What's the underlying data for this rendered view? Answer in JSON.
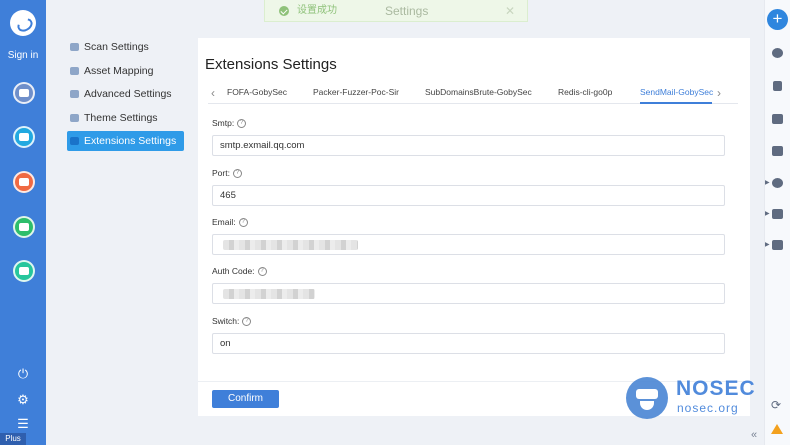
{
  "toast": {
    "message": "设置成功"
  },
  "dialog": {
    "title": "Settings"
  },
  "leftbar": {
    "signin_label": "Sign in",
    "edition_label": "Plus",
    "icons": [
      "logo-icon",
      "scan-icon",
      "list-icon",
      "screen-icon",
      "chart-icon",
      "plugin-icon",
      "power-icon",
      "settings-icon",
      "menu-icon"
    ]
  },
  "settings_menu": {
    "items": [
      {
        "label": "Scan Settings",
        "icon": "scan-settings-icon"
      },
      {
        "label": "Asset Mapping",
        "icon": "asset-mapping-icon"
      },
      {
        "label": "Advanced Settings",
        "icon": "advanced-settings-icon"
      },
      {
        "label": "Theme Settings",
        "icon": "theme-icon"
      },
      {
        "label": "Extensions Settings",
        "icon": "extensions-icon",
        "active": true
      }
    ]
  },
  "panel": {
    "title": "Extensions Settings",
    "tabs": [
      {
        "label": "FOFA-GobySec"
      },
      {
        "label": "Packer-Fuzzer-Poc-Sir"
      },
      {
        "label": "SubDomainsBrute-GobySec"
      },
      {
        "label": "Redis-cli-go0p"
      },
      {
        "label": "SendMail-GobySec",
        "active": true
      }
    ],
    "fields": {
      "smtp": {
        "label": "Smtp:",
        "value": "smtp.exmail.qq.com"
      },
      "port": {
        "label": "Port:",
        "value": "465"
      },
      "email": {
        "label": "Email:",
        "value": ""
      },
      "auth_code": {
        "label": "Auth Code:",
        "value": ""
      },
      "switch": {
        "label": "Switch:",
        "value": "on"
      }
    },
    "confirm_label": "Confirm"
  },
  "watermark": {
    "brand": "NOSEC",
    "site": "nosec.org"
  },
  "rightbar": {
    "add_symbol": "+",
    "icons": [
      "add-icon",
      "history-icon",
      "document-icon",
      "monitor-icon",
      "ip-icon",
      "bug-icon",
      "bar-chart-icon",
      "puzzle-icon",
      "refresh-icon",
      "warning-icon"
    ],
    "collapse_symbol": "«",
    "refresh_symbol": "⟳"
  },
  "colors": {
    "primary": "#3f7fd9",
    "leftbar": "#3f7fd9",
    "toast_bg": "#eef7e8",
    "toast_text": "#8fc27a"
  }
}
